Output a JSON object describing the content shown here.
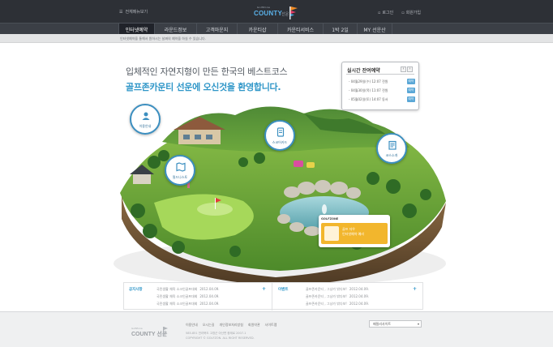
{
  "header": {
    "util_left": "전체메뉴보기",
    "logo_small": "GolfZone",
    "logo_main": "COUNTY",
    "logo_sub": "선운",
    "util_right": [
      {
        "icon": "lock-icon",
        "label": "로그인"
      },
      {
        "icon": "user-icon",
        "label": "회원가입"
      }
    ],
    "gnb": [
      {
        "label": "인터넷예약",
        "active": true
      },
      {
        "label": "라운드정보",
        "active": false
      },
      {
        "label": "고객마운지",
        "active": false
      },
      {
        "label": "카운티샵",
        "active": false
      },
      {
        "label": "카운티서비스",
        "active": false
      },
      {
        "label": "1박 2일",
        "active": false
      },
      {
        "label": "MY 선운산",
        "active": false
      }
    ],
    "sub_desc": "인터넷예약을 통해서 원하시는 날짜의 예약을 하실 수 있습니다."
  },
  "hero": {
    "line1": "입체적인 자연지형이 만든 한국의 베스트코스",
    "line2": "골프존카운티 선운에 오신것을 환영합니다."
  },
  "reservation": {
    "title": "실시간 잔여예약",
    "prev": "‹",
    "next": "›",
    "rows": [
      {
        "text": "- 04월29일(수) 12:07  전원",
        "button": "예약"
      },
      {
        "text": "- 04월30일(목) 11:07  전원",
        "button": "예약"
      },
      {
        "text": "- 05월02일(토) 14:07  동서",
        "button": "예약"
      }
    ]
  },
  "bubbles": [
    {
      "icon": "person-info-icon",
      "label": "이용안내"
    },
    {
      "icon": "map-icon",
      "label": "필드나스토"
    },
    {
      "icon": "scorecard-icon",
      "label": "스코어카드"
    },
    {
      "icon": "document-icon",
      "label": "코스소개"
    }
  ],
  "video_card": {
    "title": "GOLFZONE",
    "text_line1": "골프 자우",
    "text_line2": "인터넷예약 예리"
  },
  "notices": {
    "left": {
      "head": "공지사항",
      "plus": "+",
      "items": [
        {
          "text": "국민생활 체육 소크인골프대회",
          "date": "2012.04.09."
        },
        {
          "text": "국민생활 체육 소크인골프대회",
          "date": "2012.04.09."
        },
        {
          "text": "국민생활 체육 소크인골프대회",
          "date": "2012.04.09."
        }
      ]
    },
    "right": {
      "head": "이벤트",
      "plus": "+",
      "items": [
        {
          "text": "골프존카운티 , 그냥가 밖다보!",
          "date": "2012.04.09."
        },
        {
          "text": "골프존카운티 , 그냥가 밖다보!",
          "date": "2012.04.09."
        },
        {
          "text": "골프존카운티 , 그냥가 밖다보!",
          "date": "2012.04.09."
        }
      ]
    }
  },
  "footer": {
    "logo_small": "GolfZone",
    "logo_main": "COUNTY 선운",
    "links": [
      "이용안내",
      "오시는길",
      "개인정보처리방침",
      "회원약관",
      "사이트맵"
    ],
    "addr1": "585-851 전라북도 고창군 아산면 중제로 2007-1",
    "addr2": "COPYRIGHT © GOLFZON. ALL RIGHT RESERVED.",
    "family_label": "패밀리사이트"
  },
  "colors": {
    "topbar": "#2d3036",
    "accent": "#2f96c8",
    "grass": "#6fa63a"
  }
}
